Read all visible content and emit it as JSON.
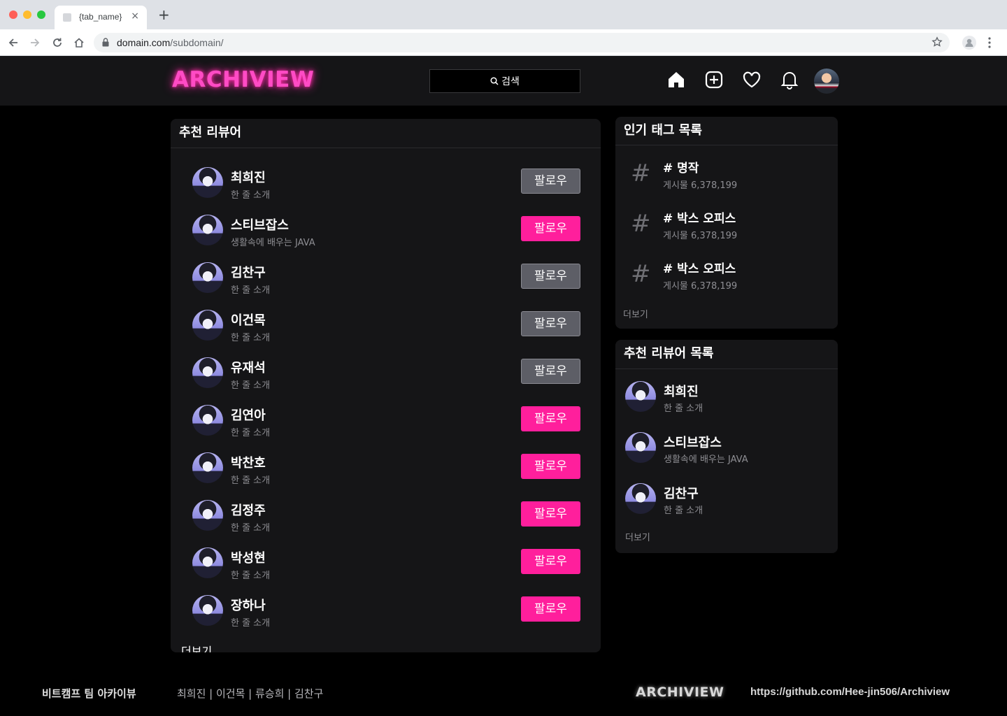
{
  "browser": {
    "tab_title": "{tab_name}",
    "tab_close": "×",
    "new_tab": "+",
    "url_host": "domain.com",
    "url_path": "/subdomain/"
  },
  "header": {
    "logo": "ARCHIVIEW",
    "search_placeholder": "검색"
  },
  "main": {
    "title": "추천 리뷰어",
    "follow_label": "팔로우",
    "more_label": "더보기",
    "reviewers": [
      {
        "name": "최희진",
        "desc": "한 줄 소개",
        "following": true
      },
      {
        "name": "스티브잡스",
        "desc": "생활속에 배우는 JAVA",
        "following": false
      },
      {
        "name": "김찬구",
        "desc": "한 줄 소개",
        "following": true
      },
      {
        "name": "이건목",
        "desc": "한 줄 소개",
        "following": true
      },
      {
        "name": "유재석",
        "desc": "한 줄 소개",
        "following": true
      },
      {
        "name": "김연아",
        "desc": "한 줄 소개",
        "following": false
      },
      {
        "name": "박찬호",
        "desc": "한 줄 소개",
        "following": false
      },
      {
        "name": "김정주",
        "desc": "한 줄 소개",
        "following": false
      },
      {
        "name": "박성현",
        "desc": "한 줄 소개",
        "following": false
      },
      {
        "name": "장하나",
        "desc": "한 줄 소개",
        "following": false
      }
    ],
    "colors": {
      "follow_active": "#ff1f9c",
      "follow_done": "#5d5e66"
    }
  },
  "tags_panel": {
    "title": "인기 태그 목록",
    "more_label": "더보기",
    "hash_symbol": "#",
    "tags": [
      {
        "name": "# 명작",
        "count": "게시물 6,378,199"
      },
      {
        "name": "# 박스 오피스",
        "count": "게시물 6,378,199"
      },
      {
        "name": "# 박스 오피스",
        "count": "게시물 6,378,199"
      }
    ]
  },
  "reviewers_panel": {
    "title": "추천 리뷰어 목록",
    "more_label": "더보기",
    "reviewers": [
      {
        "name": "최희진",
        "desc": "한 줄 소개"
      },
      {
        "name": "스티브잡스",
        "desc": "생활속에 배우는 JAVA"
      },
      {
        "name": "김찬구",
        "desc": "한 줄 소개"
      }
    ]
  },
  "footer": {
    "team": "비트캠프 팀 아카이뷰",
    "members": "최희진 | 이건목 | 류승희 | 김찬구",
    "logo": "ARCHIVIEW",
    "link": "https://github.com/Hee-jin506/Archiview"
  }
}
